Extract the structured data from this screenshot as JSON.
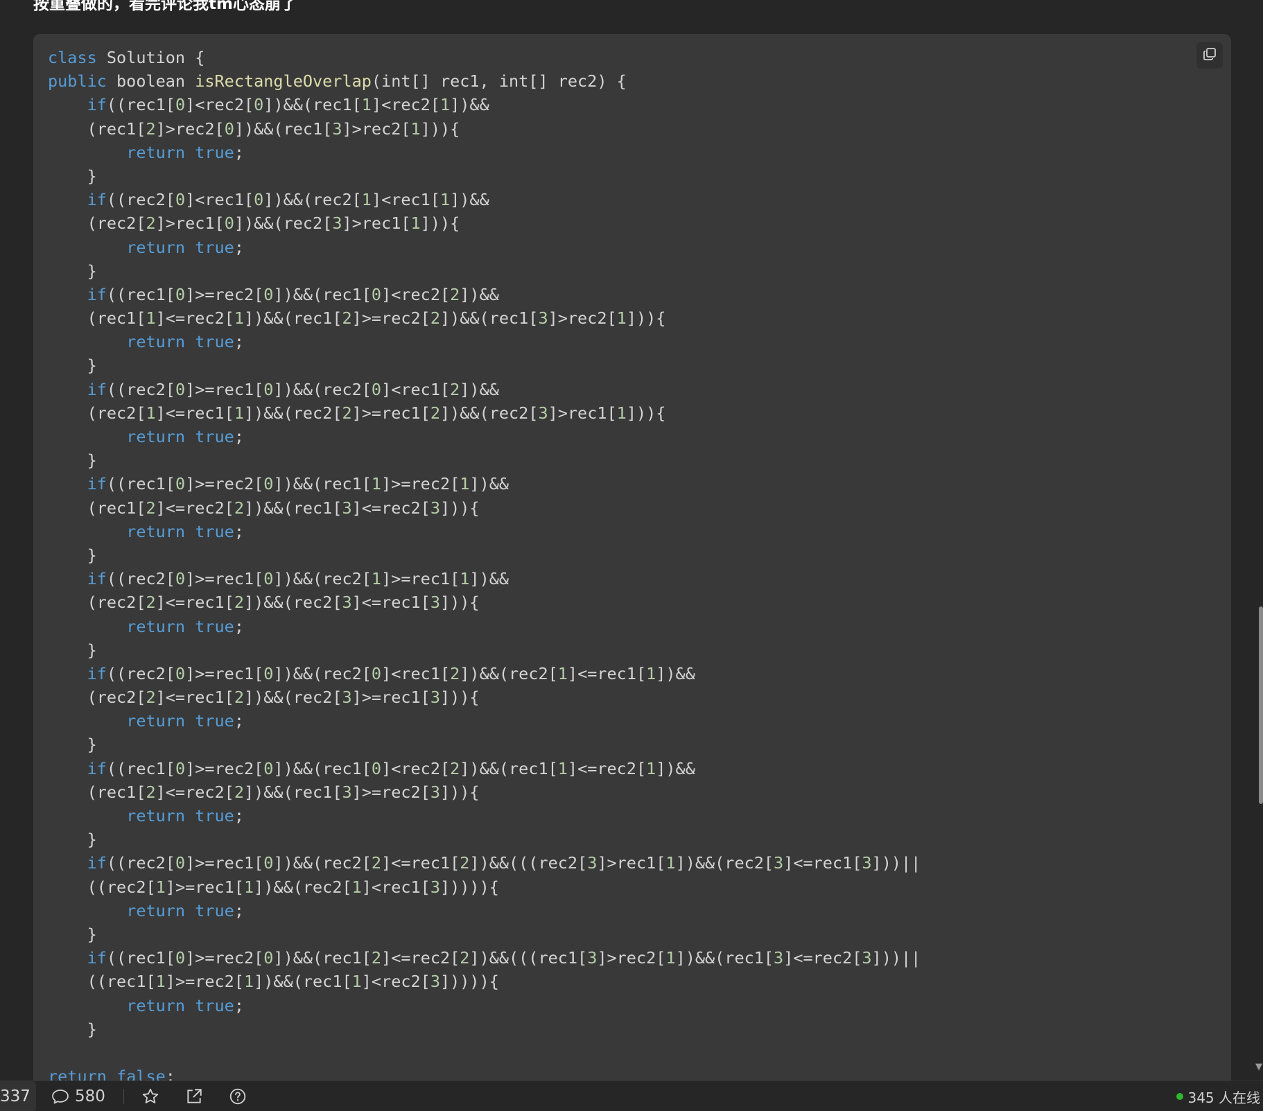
{
  "top_text": "按重叠做的，看完评论我tm心态崩了",
  "code_lines": [
    [
      [
        "kw",
        "class"
      ],
      [
        "txt",
        " Solution {"
      ]
    ],
    [
      [
        "kw",
        "public"
      ],
      [
        "txt",
        " boolean "
      ],
      [
        "fn",
        "isRectangleOverlap"
      ],
      [
        "txt",
        "(int[] rec1, int[] rec2) {"
      ]
    ],
    [
      [
        "txt",
        "    "
      ],
      [
        "kw",
        "if"
      ],
      [
        "txt",
        "((rec1["
      ],
      [
        "num",
        "0"
      ],
      [
        "txt",
        "]<rec2["
      ],
      [
        "num",
        "0"
      ],
      [
        "txt",
        "])&&(rec1["
      ],
      [
        "num",
        "1"
      ],
      [
        "txt",
        "]<rec2["
      ],
      [
        "num",
        "1"
      ],
      [
        "txt",
        "])&&"
      ]
    ],
    [
      [
        "txt",
        "    (rec1["
      ],
      [
        "num",
        "2"
      ],
      [
        "txt",
        "]>rec2["
      ],
      [
        "num",
        "0"
      ],
      [
        "txt",
        "])&&(rec1["
      ],
      [
        "num",
        "3"
      ],
      [
        "txt",
        "]>rec2["
      ],
      [
        "num",
        "1"
      ],
      [
        "txt",
        "])){"
      ]
    ],
    [
      [
        "txt",
        "        "
      ],
      [
        "kw",
        "return"
      ],
      [
        "txt",
        " "
      ],
      [
        "kw",
        "true"
      ],
      [
        "txt",
        ";"
      ]
    ],
    [
      [
        "txt",
        "    }"
      ]
    ],
    [
      [
        "txt",
        "    "
      ],
      [
        "kw",
        "if"
      ],
      [
        "txt",
        "((rec2["
      ],
      [
        "num",
        "0"
      ],
      [
        "txt",
        "]<rec1["
      ],
      [
        "num",
        "0"
      ],
      [
        "txt",
        "])&&(rec2["
      ],
      [
        "num",
        "1"
      ],
      [
        "txt",
        "]<rec1["
      ],
      [
        "num",
        "1"
      ],
      [
        "txt",
        "])&&"
      ]
    ],
    [
      [
        "txt",
        "    (rec2["
      ],
      [
        "num",
        "2"
      ],
      [
        "txt",
        "]>rec1["
      ],
      [
        "num",
        "0"
      ],
      [
        "txt",
        "])&&(rec2["
      ],
      [
        "num",
        "3"
      ],
      [
        "txt",
        "]>rec1["
      ],
      [
        "num",
        "1"
      ],
      [
        "txt",
        "])){"
      ]
    ],
    [
      [
        "txt",
        "        "
      ],
      [
        "kw",
        "return"
      ],
      [
        "txt",
        " "
      ],
      [
        "kw",
        "true"
      ],
      [
        "txt",
        ";"
      ]
    ],
    [
      [
        "txt",
        "    }"
      ]
    ],
    [
      [
        "txt",
        "    "
      ],
      [
        "kw",
        "if"
      ],
      [
        "txt",
        "((rec1["
      ],
      [
        "num",
        "0"
      ],
      [
        "txt",
        "]>=rec2["
      ],
      [
        "num",
        "0"
      ],
      [
        "txt",
        "])&&(rec1["
      ],
      [
        "num",
        "0"
      ],
      [
        "txt",
        "]<rec2["
      ],
      [
        "num",
        "2"
      ],
      [
        "txt",
        "])&&"
      ]
    ],
    [
      [
        "txt",
        "    (rec1["
      ],
      [
        "num",
        "1"
      ],
      [
        "txt",
        "]<=rec2["
      ],
      [
        "num",
        "1"
      ],
      [
        "txt",
        "])&&(rec1["
      ],
      [
        "num",
        "2"
      ],
      [
        "txt",
        "]>=rec2["
      ],
      [
        "num",
        "2"
      ],
      [
        "txt",
        "])&&(rec1["
      ],
      [
        "num",
        "3"
      ],
      [
        "txt",
        "]>rec2["
      ],
      [
        "num",
        "1"
      ],
      [
        "txt",
        "])){"
      ]
    ],
    [
      [
        "txt",
        "        "
      ],
      [
        "kw",
        "return"
      ],
      [
        "txt",
        " "
      ],
      [
        "kw",
        "true"
      ],
      [
        "txt",
        ";"
      ]
    ],
    [
      [
        "txt",
        "    }"
      ]
    ],
    [
      [
        "txt",
        "    "
      ],
      [
        "kw",
        "if"
      ],
      [
        "txt",
        "((rec2["
      ],
      [
        "num",
        "0"
      ],
      [
        "txt",
        "]>=rec1["
      ],
      [
        "num",
        "0"
      ],
      [
        "txt",
        "])&&(rec2["
      ],
      [
        "num",
        "0"
      ],
      [
        "txt",
        "]<rec1["
      ],
      [
        "num",
        "2"
      ],
      [
        "txt",
        "])&&"
      ]
    ],
    [
      [
        "txt",
        "    (rec2["
      ],
      [
        "num",
        "1"
      ],
      [
        "txt",
        "]<=rec1["
      ],
      [
        "num",
        "1"
      ],
      [
        "txt",
        "])&&(rec2["
      ],
      [
        "num",
        "2"
      ],
      [
        "txt",
        "]>=rec1["
      ],
      [
        "num",
        "2"
      ],
      [
        "txt",
        "])&&(rec2["
      ],
      [
        "num",
        "3"
      ],
      [
        "txt",
        "]>rec1["
      ],
      [
        "num",
        "1"
      ],
      [
        "txt",
        "])){"
      ]
    ],
    [
      [
        "txt",
        "        "
      ],
      [
        "kw",
        "return"
      ],
      [
        "txt",
        " "
      ],
      [
        "kw",
        "true"
      ],
      [
        "txt",
        ";"
      ]
    ],
    [
      [
        "txt",
        "    }"
      ]
    ],
    [
      [
        "txt",
        "    "
      ],
      [
        "kw",
        "if"
      ],
      [
        "txt",
        "((rec1["
      ],
      [
        "num",
        "0"
      ],
      [
        "txt",
        "]>=rec2["
      ],
      [
        "num",
        "0"
      ],
      [
        "txt",
        "])&&(rec1["
      ],
      [
        "num",
        "1"
      ],
      [
        "txt",
        "]>=rec2["
      ],
      [
        "num",
        "1"
      ],
      [
        "txt",
        "])&&"
      ]
    ],
    [
      [
        "txt",
        "    (rec1["
      ],
      [
        "num",
        "2"
      ],
      [
        "txt",
        "]<=rec2["
      ],
      [
        "num",
        "2"
      ],
      [
        "txt",
        "])&&(rec1["
      ],
      [
        "num",
        "3"
      ],
      [
        "txt",
        "]<=rec2["
      ],
      [
        "num",
        "3"
      ],
      [
        "txt",
        "])){"
      ]
    ],
    [
      [
        "txt",
        "        "
      ],
      [
        "kw",
        "return"
      ],
      [
        "txt",
        " "
      ],
      [
        "kw",
        "true"
      ],
      [
        "txt",
        ";"
      ]
    ],
    [
      [
        "txt",
        "    }"
      ]
    ],
    [
      [
        "txt",
        "    "
      ],
      [
        "kw",
        "if"
      ],
      [
        "txt",
        "((rec2["
      ],
      [
        "num",
        "0"
      ],
      [
        "txt",
        "]>=rec1["
      ],
      [
        "num",
        "0"
      ],
      [
        "txt",
        "])&&(rec2["
      ],
      [
        "num",
        "1"
      ],
      [
        "txt",
        "]>=rec1["
      ],
      [
        "num",
        "1"
      ],
      [
        "txt",
        "])&&"
      ]
    ],
    [
      [
        "txt",
        "    (rec2["
      ],
      [
        "num",
        "2"
      ],
      [
        "txt",
        "]<=rec1["
      ],
      [
        "num",
        "2"
      ],
      [
        "txt",
        "])&&(rec2["
      ],
      [
        "num",
        "3"
      ],
      [
        "txt",
        "]<=rec1["
      ],
      [
        "num",
        "3"
      ],
      [
        "txt",
        "])){"
      ]
    ],
    [
      [
        "txt",
        "        "
      ],
      [
        "kw",
        "return"
      ],
      [
        "txt",
        " "
      ],
      [
        "kw",
        "true"
      ],
      [
        "txt",
        ";"
      ]
    ],
    [
      [
        "txt",
        "    }"
      ]
    ],
    [
      [
        "txt",
        "    "
      ],
      [
        "kw",
        "if"
      ],
      [
        "txt",
        "((rec2["
      ],
      [
        "num",
        "0"
      ],
      [
        "txt",
        "]>=rec1["
      ],
      [
        "num",
        "0"
      ],
      [
        "txt",
        "])&&(rec2["
      ],
      [
        "num",
        "0"
      ],
      [
        "txt",
        "]<rec1["
      ],
      [
        "num",
        "2"
      ],
      [
        "txt",
        "])&&(rec2["
      ],
      [
        "num",
        "1"
      ],
      [
        "txt",
        "]<=rec1["
      ],
      [
        "num",
        "1"
      ],
      [
        "txt",
        "])&&"
      ]
    ],
    [
      [
        "txt",
        "    (rec2["
      ],
      [
        "num",
        "2"
      ],
      [
        "txt",
        "]<=rec1["
      ],
      [
        "num",
        "2"
      ],
      [
        "txt",
        "])&&(rec2["
      ],
      [
        "num",
        "3"
      ],
      [
        "txt",
        "]>=rec1["
      ],
      [
        "num",
        "3"
      ],
      [
        "txt",
        "])){"
      ]
    ],
    [
      [
        "txt",
        "        "
      ],
      [
        "kw",
        "return"
      ],
      [
        "txt",
        " "
      ],
      [
        "kw",
        "true"
      ],
      [
        "txt",
        ";"
      ]
    ],
    [
      [
        "txt",
        "    }"
      ]
    ],
    [
      [
        "txt",
        "    "
      ],
      [
        "kw",
        "if"
      ],
      [
        "txt",
        "((rec1["
      ],
      [
        "num",
        "0"
      ],
      [
        "txt",
        "]>=rec2["
      ],
      [
        "num",
        "0"
      ],
      [
        "txt",
        "])&&(rec1["
      ],
      [
        "num",
        "0"
      ],
      [
        "txt",
        "]<rec2["
      ],
      [
        "num",
        "2"
      ],
      [
        "txt",
        "])&&(rec1["
      ],
      [
        "num",
        "1"
      ],
      [
        "txt",
        "]<=rec2["
      ],
      [
        "num",
        "1"
      ],
      [
        "txt",
        "])&&"
      ]
    ],
    [
      [
        "txt",
        "    (rec1["
      ],
      [
        "num",
        "2"
      ],
      [
        "txt",
        "]<=rec2["
      ],
      [
        "num",
        "2"
      ],
      [
        "txt",
        "])&&(rec1["
      ],
      [
        "num",
        "3"
      ],
      [
        "txt",
        "]>=rec2["
      ],
      [
        "num",
        "3"
      ],
      [
        "txt",
        "])){"
      ]
    ],
    [
      [
        "txt",
        "        "
      ],
      [
        "kw",
        "return"
      ],
      [
        "txt",
        " "
      ],
      [
        "kw",
        "true"
      ],
      [
        "txt",
        ";"
      ]
    ],
    [
      [
        "txt",
        "    }"
      ]
    ],
    [
      [
        "txt",
        "    "
      ],
      [
        "kw",
        "if"
      ],
      [
        "txt",
        "((rec2["
      ],
      [
        "num",
        "0"
      ],
      [
        "txt",
        "]>=rec1["
      ],
      [
        "num",
        "0"
      ],
      [
        "txt",
        "])&&(rec2["
      ],
      [
        "num",
        "2"
      ],
      [
        "txt",
        "]<=rec1["
      ],
      [
        "num",
        "2"
      ],
      [
        "txt",
        "])&&(((rec2["
      ],
      [
        "num",
        "3"
      ],
      [
        "txt",
        "]>rec1["
      ],
      [
        "num",
        "1"
      ],
      [
        "txt",
        "])&&(rec2["
      ],
      [
        "num",
        "3"
      ],
      [
        "txt",
        "]<=rec1["
      ],
      [
        "num",
        "3"
      ],
      [
        "txt",
        "]))||"
      ]
    ],
    [
      [
        "txt",
        "    ((rec2["
      ],
      [
        "num",
        "1"
      ],
      [
        "txt",
        "]>=rec1["
      ],
      [
        "num",
        "1"
      ],
      [
        "txt",
        "])&&(rec2["
      ],
      [
        "num",
        "1"
      ],
      [
        "txt",
        "]<rec1["
      ],
      [
        "num",
        "3"
      ],
      [
        "txt",
        "])))){"
      ]
    ],
    [
      [
        "txt",
        "        "
      ],
      [
        "kw",
        "return"
      ],
      [
        "txt",
        " "
      ],
      [
        "kw",
        "true"
      ],
      [
        "txt",
        ";"
      ]
    ],
    [
      [
        "txt",
        "    }"
      ]
    ],
    [
      [
        "txt",
        "    "
      ],
      [
        "kw",
        "if"
      ],
      [
        "txt",
        "((rec1["
      ],
      [
        "num",
        "0"
      ],
      [
        "txt",
        "]>=rec2["
      ],
      [
        "num",
        "0"
      ],
      [
        "txt",
        "])&&(rec1["
      ],
      [
        "num",
        "2"
      ],
      [
        "txt",
        "]<=rec2["
      ],
      [
        "num",
        "2"
      ],
      [
        "txt",
        "])&&(((rec1["
      ],
      [
        "num",
        "3"
      ],
      [
        "txt",
        "]>rec2["
      ],
      [
        "num",
        "1"
      ],
      [
        "txt",
        "])&&(rec1["
      ],
      [
        "num",
        "3"
      ],
      [
        "txt",
        "]<=rec2["
      ],
      [
        "num",
        "3"
      ],
      [
        "txt",
        "]))||"
      ]
    ],
    [
      [
        "txt",
        "    ((rec1["
      ],
      [
        "num",
        "1"
      ],
      [
        "txt",
        "]>=rec2["
      ],
      [
        "num",
        "1"
      ],
      [
        "txt",
        "])&&(rec1["
      ],
      [
        "num",
        "1"
      ],
      [
        "txt",
        "]<rec2["
      ],
      [
        "num",
        "3"
      ],
      [
        "txt",
        "])))){"
      ]
    ],
    [
      [
        "txt",
        "        "
      ],
      [
        "kw",
        "return"
      ],
      [
        "txt",
        " "
      ],
      [
        "kw",
        "true"
      ],
      [
        "txt",
        ";"
      ]
    ],
    [
      [
        "txt",
        "    }"
      ]
    ],
    [
      [
        "txt",
        ""
      ]
    ],
    [
      [
        "kw",
        "return"
      ],
      [
        "txt",
        " "
      ],
      [
        "kw",
        "false"
      ],
      [
        "txt",
        ";"
      ]
    ]
  ],
  "bottom_bar": {
    "like_count": "337",
    "comment_count": "580",
    "online_text": "345 人在线"
  },
  "icons": {
    "copy": "copy-icon",
    "comment": "comment-icon",
    "star": "star-icon",
    "share": "share-icon",
    "help": "help-icon"
  },
  "colors": {
    "background": "#262626",
    "code_background": "#393939",
    "keyword": "#569cd6",
    "function": "#dcdcaa",
    "number": "#b5cea8",
    "text": "#d4d4d4",
    "online_dot": "#2eb82e"
  }
}
